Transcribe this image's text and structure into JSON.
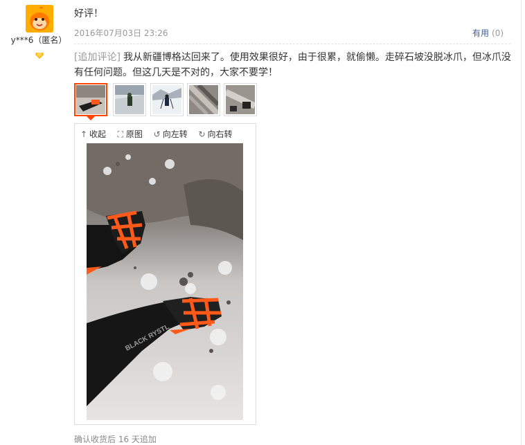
{
  "review": {
    "username": "y***6（匿名）",
    "title": "好评！",
    "date": "2016年07月03日 23:26",
    "useful_label": "有用",
    "useful_count": "(0)",
    "followup_tag": "[追加评论]",
    "followup_text": "我从新疆博格达回来了。使用效果很好，由于很累，就偷懒。走碎石坡没脱冰爪，但冰爪没有任何问题。但这几天是不对的，大家不要学！",
    "footer": "确认收货后 16 天追加"
  },
  "viewer": {
    "collapse": "收起",
    "original": "原图",
    "rotate_left": "向左转",
    "rotate_right": "向右转"
  },
  "colors": {
    "accent": "#ff4400",
    "link": "#3c5e97",
    "crampon": "#ff5a1a"
  }
}
